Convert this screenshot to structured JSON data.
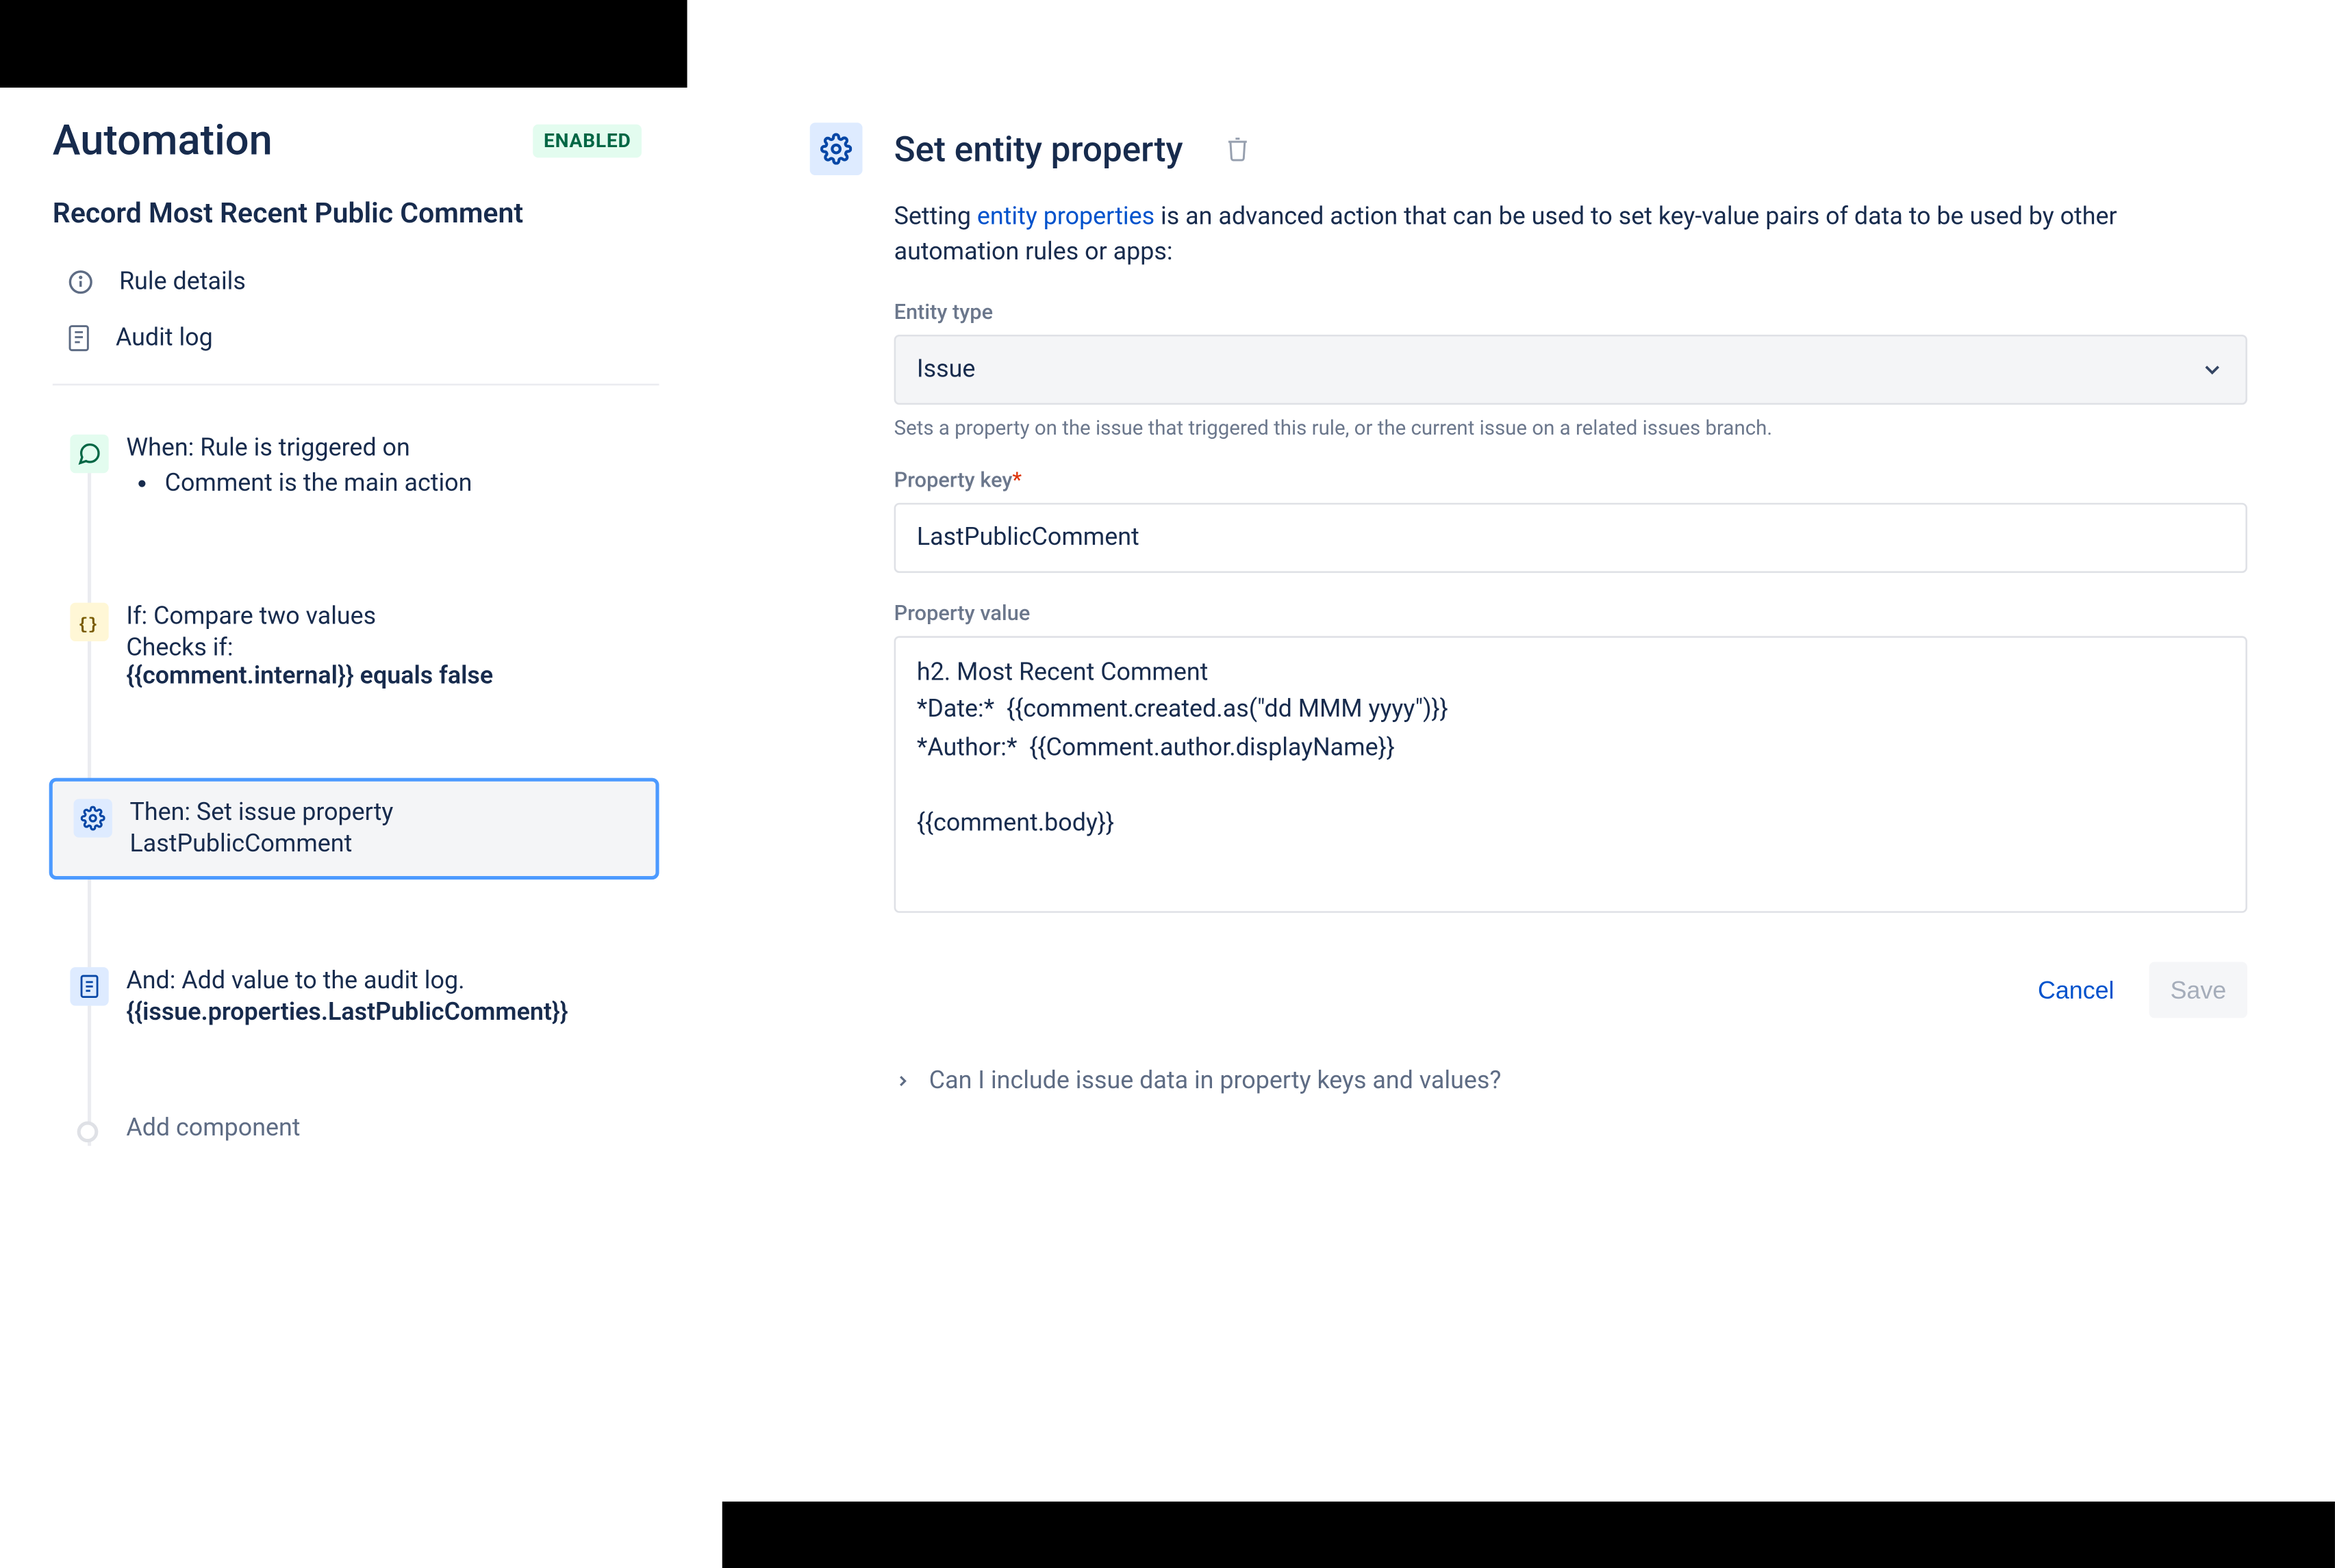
{
  "sidebar": {
    "title": "Automation",
    "status_badge": "ENABLED",
    "rule_name": "Record Most Recent Public Comment",
    "nav": {
      "details": "Rule details",
      "audit": "Audit log"
    },
    "steps": {
      "trigger": {
        "title": "When: Rule is triggered on",
        "bullet": "Comment is the main action"
      },
      "condition": {
        "title": "If: Compare two values",
        "line1": "Checks if:",
        "line2": "{{comment.internal}} equals false"
      },
      "action": {
        "title": "Then: Set issue property",
        "sub": "LastPublicComment"
      },
      "log": {
        "title": "And: Add value to the audit log.",
        "sub": "{{issue.properties.LastPublicComment}}"
      }
    },
    "add_component": "Add component"
  },
  "main": {
    "heading": "Set entity property",
    "description_prefix": "Setting ",
    "description_link": "entity properties",
    "description_suffix": " is an advanced action that can be used to set key-value pairs of data to be used by other automation rules or apps:",
    "entity_type": {
      "label": "Entity type",
      "value": "Issue",
      "helper": "Sets a property on the issue that triggered this rule, or the current issue on a related issues branch."
    },
    "property_key": {
      "label": "Property key",
      "value": "LastPublicComment"
    },
    "property_value": {
      "label": "Property value",
      "value": "h2. Most Recent Comment\n*Date:*  {{comment.created.as(\"dd MMM yyyy\")}}\n*Author:*  {{Comment.author.displayName}}\n\n{{comment.body}}"
    },
    "buttons": {
      "cancel": "Cancel",
      "save": "Save"
    },
    "expander": "Can I include issue data in property keys and values?"
  }
}
